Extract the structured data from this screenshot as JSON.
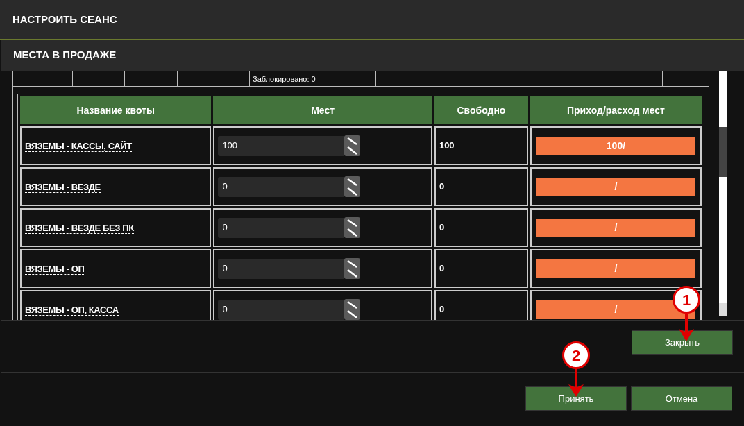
{
  "window": {
    "title": "НАСТРОИТЬ СЕАНС"
  },
  "dialog": {
    "title": "МЕСТА В ПРОДАЖЕ",
    "partial_row": {
      "text": "Заблокировано: 0"
    },
    "table": {
      "columns": [
        "Название квоты",
        "Мест",
        "Свободно",
        "Приход/расход мест"
      ],
      "rows": [
        {
          "name": "ВЯЗЕМЫ - КАССЫ, САЙТ",
          "seats": "100",
          "free": "100",
          "flow": "100/"
        },
        {
          "name": "ВЯЗЕМЫ - ВЕЗДЕ",
          "seats": "0",
          "free": "0",
          "flow": "/"
        },
        {
          "name": "ВЯЗЕМЫ - ВЕЗДЕ БЕЗ ПК",
          "seats": "0",
          "free": "0",
          "flow": "/"
        },
        {
          "name": "ВЯЗЕМЫ - ОП",
          "seats": "0",
          "free": "0",
          "flow": "/"
        },
        {
          "name": "ВЯЗЕМЫ - ОП, КАССА",
          "seats": "0",
          "free": "0",
          "flow": "/"
        }
      ]
    },
    "close_button": "Закрыть"
  },
  "footer_buttons": [
    "Принять",
    "Отмена"
  ],
  "callouts": [
    {
      "number": "1"
    },
    {
      "number": "2"
    }
  ]
}
